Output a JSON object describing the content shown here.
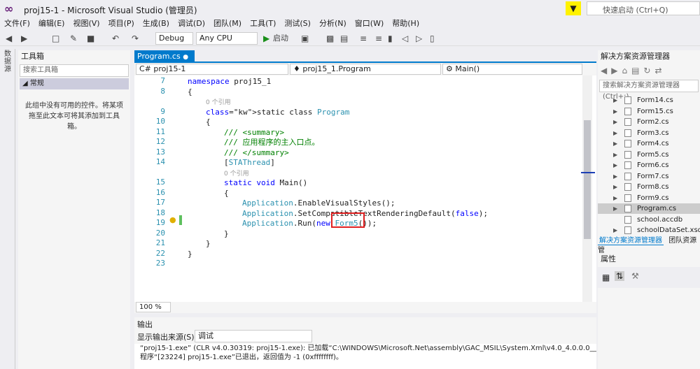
{
  "window": {
    "title": "proj15-1 - Microsoft Visual Studio (管理员)",
    "quick_launch_placeholder": "快速启动 (Ctrl+Q)"
  },
  "menu": [
    "文件(F)",
    "编辑(E)",
    "视图(V)",
    "项目(P)",
    "生成(B)",
    "调试(D)",
    "团队(M)",
    "工具(T)",
    "测试(S)",
    "分析(N)",
    "窗口(W)",
    "帮助(H)"
  ],
  "toolbar": {
    "config": "Debug",
    "platform": "Any CPU",
    "start": "启动"
  },
  "left_strip": "数据源",
  "toolbox": {
    "title": "工具箱",
    "search_placeholder": "搜索工具箱",
    "section": "常规",
    "empty_text": "此组中没有可用的控件。将某项拖至此文本可将其添加到工具箱。"
  },
  "editor": {
    "tab": "Program.cs",
    "nav": {
      "project": "proj15-1",
      "class": "proj15_1.Program",
      "member": "Main()"
    },
    "line_numbers": [
      "7",
      "8",
      "",
      "9",
      "10",
      "11",
      "12",
      "13",
      "14",
      "",
      "15",
      "16",
      "17",
      "18",
      "19",
      "20",
      "21",
      "22",
      "23"
    ],
    "lines": [
      {
        "t": "namespace proj15_1",
        "c": "kw-ns",
        "i": 0
      },
      {
        "t": "{",
        "c": "",
        "i": 0
      },
      {
        "t": "0 个引用",
        "c": "ref",
        "i": 2
      },
      {
        "t": "static class Program",
        "c": "cls",
        "i": 2
      },
      {
        "t": "{",
        "c": "",
        "i": 2
      },
      {
        "t": "/// <summary>",
        "c": "cm",
        "i": 4
      },
      {
        "t": "/// 应用程序的主入口点。",
        "c": "cm",
        "i": 4
      },
      {
        "t": "/// </summary>",
        "c": "cm",
        "i": 4
      },
      {
        "t": "[STAThread]",
        "c": "attr",
        "i": 4
      },
      {
        "t": "0 个引用",
        "c": "ref",
        "i": 4
      },
      {
        "t": "static void Main()",
        "c": "main",
        "i": 4
      },
      {
        "t": "{",
        "c": "",
        "i": 4
      },
      {
        "t": "Application.EnableVisualStyles();",
        "c": "app",
        "i": 6
      },
      {
        "t": "Application.SetCompatibleTextRenderingDefault(false);",
        "c": "app",
        "i": 6
      },
      {
        "t": "Application.Run(new Form5());",
        "c": "app",
        "i": 6
      },
      {
        "t": "}",
        "c": "",
        "i": 4
      },
      {
        "t": "}",
        "c": "",
        "i": 2
      },
      {
        "t": "}",
        "c": "",
        "i": 0
      },
      {
        "t": "",
        "c": "",
        "i": 0
      }
    ],
    "zoom": "100 %"
  },
  "output": {
    "title": "输出",
    "source_label": "显示输出来源(S):",
    "source_value": "调试",
    "lines": [
      "“proj15-1.exe” (CLR v4.0.30319: proj15-1.exe): 已加载“C:\\WINDOWS\\Microsoft.Net\\assembly\\GAC_MSIL\\System.Xml\\v4.0_4.0.0.0__b77a5c",
      "程序“[23224] proj15-1.exe”已退出，返回值为 -1 (0xffffffff)。"
    ]
  },
  "solution_explorer": {
    "title": "解决方案资源管理器",
    "search_placeholder": "搜索解决方案资源管理器(Ctrl+;)",
    "items": [
      "Form14.cs",
      "Form15.cs",
      "Form2.cs",
      "Form3.cs",
      "Form4.cs",
      "Form5.cs",
      "Form6.cs",
      "Form7.cs",
      "Form8.cs",
      "Form9.cs",
      "Program.cs",
      "school.accdb",
      "schoolDataSet.xsd"
    ],
    "selected": "Program.cs",
    "tabs": [
      "解决方案资源管理器",
      "团队资源管"
    ],
    "properties_title": "属性"
  }
}
